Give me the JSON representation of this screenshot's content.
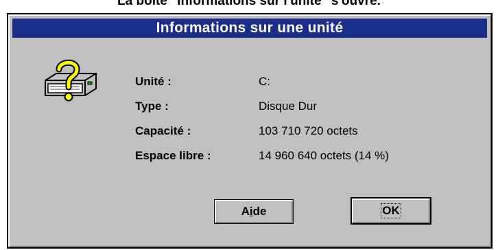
{
  "caption": "La boîte \"Informations sur l'unité\" s'ouvre.",
  "dialog": {
    "title": "Informations sur une unité",
    "icon": "drive-question-icon",
    "fields": [
      {
        "label": "Unité :",
        "value": "C:"
      },
      {
        "label": "Type :",
        "value": "Disque Dur"
      },
      {
        "label": "Capacité :",
        "value": "103 710 720 octets"
      },
      {
        "label": "Espace libre :",
        "value": "14 960 640 octets (14 %)"
      }
    ],
    "buttons": {
      "help": {
        "pre": "A",
        "mnemonic": "i",
        "post": "de"
      },
      "ok": "OK"
    }
  },
  "colors": {
    "titlebar": "#1a2f8a",
    "face": "#c0c0c0"
  }
}
